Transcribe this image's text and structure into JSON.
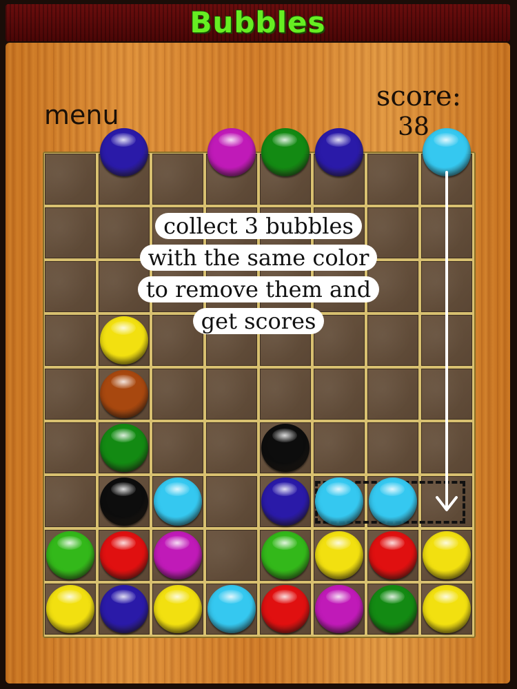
{
  "title": "Bubbles",
  "menu_label": "menu",
  "score": {
    "label": "score:",
    "value": "38"
  },
  "hint_lines": [
    "collect 3 bubbles",
    "with the same color",
    "to remove them and",
    "get scores"
  ],
  "colors": {
    "title_green": "#66ee22",
    "title_bar": "#5a0a0a",
    "wood": "#d98530",
    "cell": "#5f4a38",
    "board_frame": "#d8c070"
  },
  "next_bubbles": [
    {
      "slot": 1,
      "color": "blue"
    },
    {
      "slot": 3,
      "color": "magenta"
    },
    {
      "slot": 4,
      "color": "green"
    },
    {
      "slot": 5,
      "color": "blue"
    },
    {
      "slot": 7,
      "color": "cyan"
    }
  ],
  "board": {
    "rows": 9,
    "cols": 8,
    "bubbles": [
      {
        "row": 3,
        "col": 1,
        "color": "yellow"
      },
      {
        "row": 4,
        "col": 1,
        "color": "brown"
      },
      {
        "row": 5,
        "col": 1,
        "color": "green"
      },
      {
        "row": 5,
        "col": 4,
        "color": "black"
      },
      {
        "row": 6,
        "col": 1,
        "color": "black"
      },
      {
        "row": 6,
        "col": 2,
        "color": "cyan"
      },
      {
        "row": 6,
        "col": 4,
        "color": "blue"
      },
      {
        "row": 6,
        "col": 5,
        "color": "cyan"
      },
      {
        "row": 6,
        "col": 6,
        "color": "cyan"
      },
      {
        "row": 7,
        "col": 0,
        "color": "lime"
      },
      {
        "row": 7,
        "col": 1,
        "color": "red"
      },
      {
        "row": 7,
        "col": 2,
        "color": "magenta"
      },
      {
        "row": 7,
        "col": 4,
        "color": "lime"
      },
      {
        "row": 7,
        "col": 5,
        "color": "yellow"
      },
      {
        "row": 7,
        "col": 6,
        "color": "red"
      },
      {
        "row": 7,
        "col": 7,
        "color": "yellow"
      },
      {
        "row": 8,
        "col": 0,
        "color": "yellow"
      },
      {
        "row": 8,
        "col": 1,
        "color": "blue"
      },
      {
        "row": 8,
        "col": 2,
        "color": "yellow"
      },
      {
        "row": 8,
        "col": 3,
        "color": "cyan"
      },
      {
        "row": 8,
        "col": 4,
        "color": "red"
      },
      {
        "row": 8,
        "col": 5,
        "color": "magenta"
      },
      {
        "row": 8,
        "col": 6,
        "color": "green"
      },
      {
        "row": 8,
        "col": 7,
        "color": "yellow"
      }
    ]
  },
  "ball_colors": {
    "blue": "#2a1aa8",
    "magenta": "#c01ab8",
    "green": "#138a13",
    "lime": "#33b81a",
    "cyan": "#35c8f0",
    "yellow": "#f2e010",
    "brown": "#a8480f",
    "black": "#0d0d0d",
    "red": "#e01010"
  }
}
